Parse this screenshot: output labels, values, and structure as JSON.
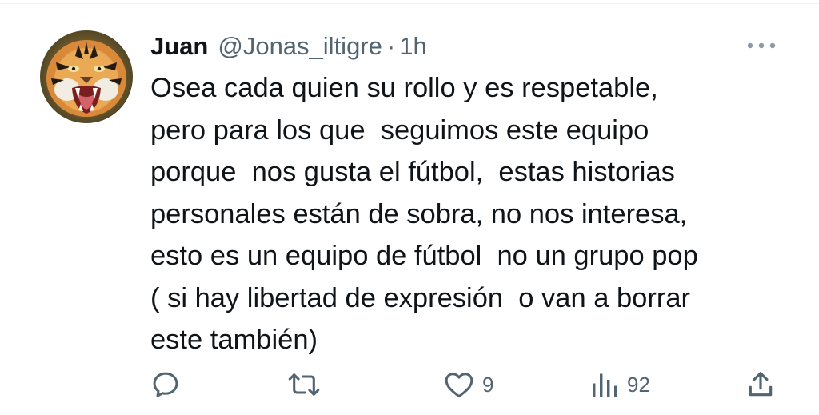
{
  "colors": {
    "text_primary": "#0f1419",
    "text_secondary": "#536471",
    "divider": "#eff3f4"
  },
  "tweet": {
    "display_name": "Juan",
    "handle": "@Jonas_iltigre",
    "separator": "·",
    "time": "1h",
    "avatar_icon": "tiger-avatar",
    "more_icon": "more-horizontal-icon",
    "text_lines": [
      "Osea cada quien su rollo y es respetable,",
      "pero para los que  seguimos este equipo",
      "porque  nos gusta el fútbol,  estas historias",
      "personales están de sobra, no nos interesa,",
      "esto es un equipo de fútbol  no un grupo pop",
      "( si hay libertad de expresión  o van a borrar",
      "este también)"
    ]
  },
  "actions": {
    "reply": {
      "icon": "reply-icon",
      "count": ""
    },
    "retweet": {
      "icon": "retweet-icon",
      "count": ""
    },
    "like": {
      "icon": "heart-icon",
      "count": "9"
    },
    "views": {
      "icon": "views-chart-icon",
      "count": "92"
    },
    "share": {
      "icon": "share-icon"
    }
  }
}
